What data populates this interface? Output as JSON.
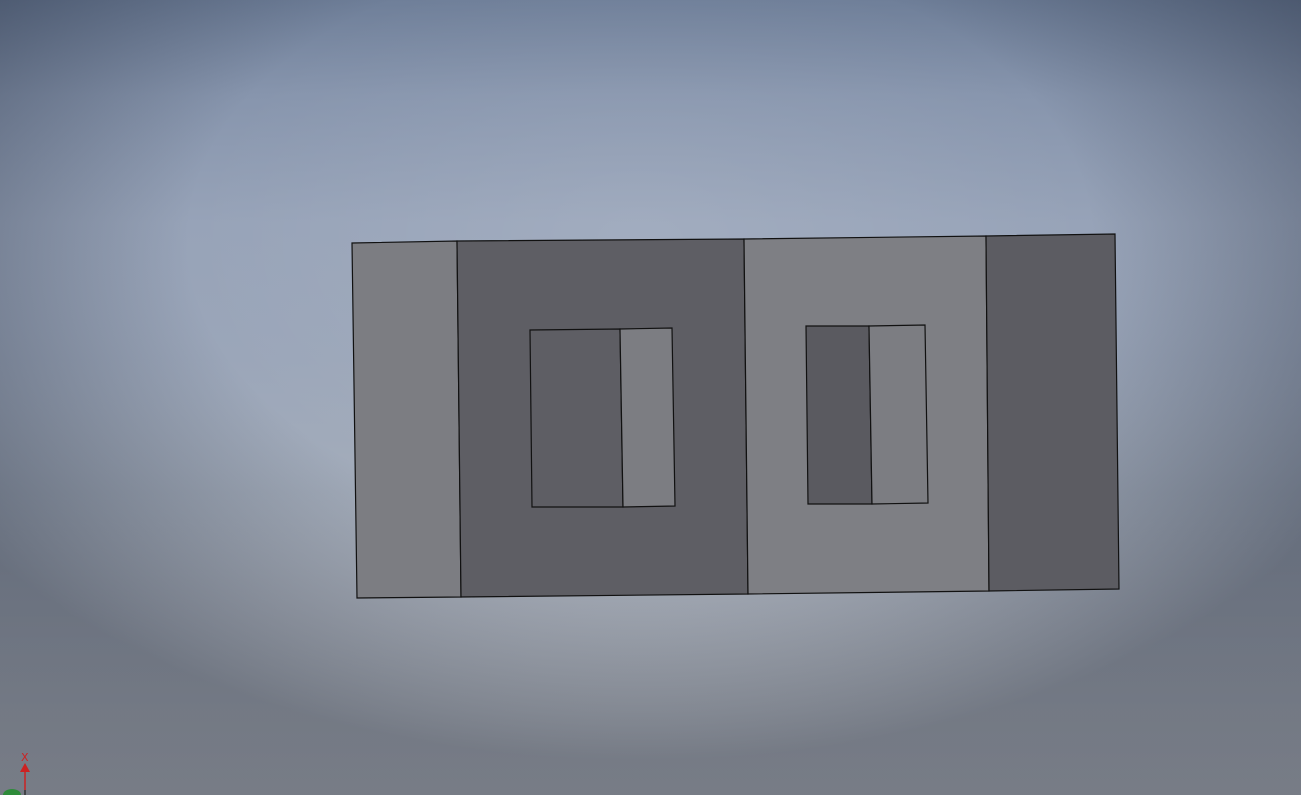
{
  "viewport": {
    "background_top_color": "#6f7f99",
    "background_bottom_color": "#c9cbcf"
  },
  "model": {
    "face_color_light": "#7c7d82",
    "face_color_dark": "#5e5e64",
    "edge_color": "#111111"
  },
  "view_triad": {
    "x_axis_label": "X",
    "x_axis_color": "#cc2222",
    "origin_color": "#2e8b3a"
  }
}
